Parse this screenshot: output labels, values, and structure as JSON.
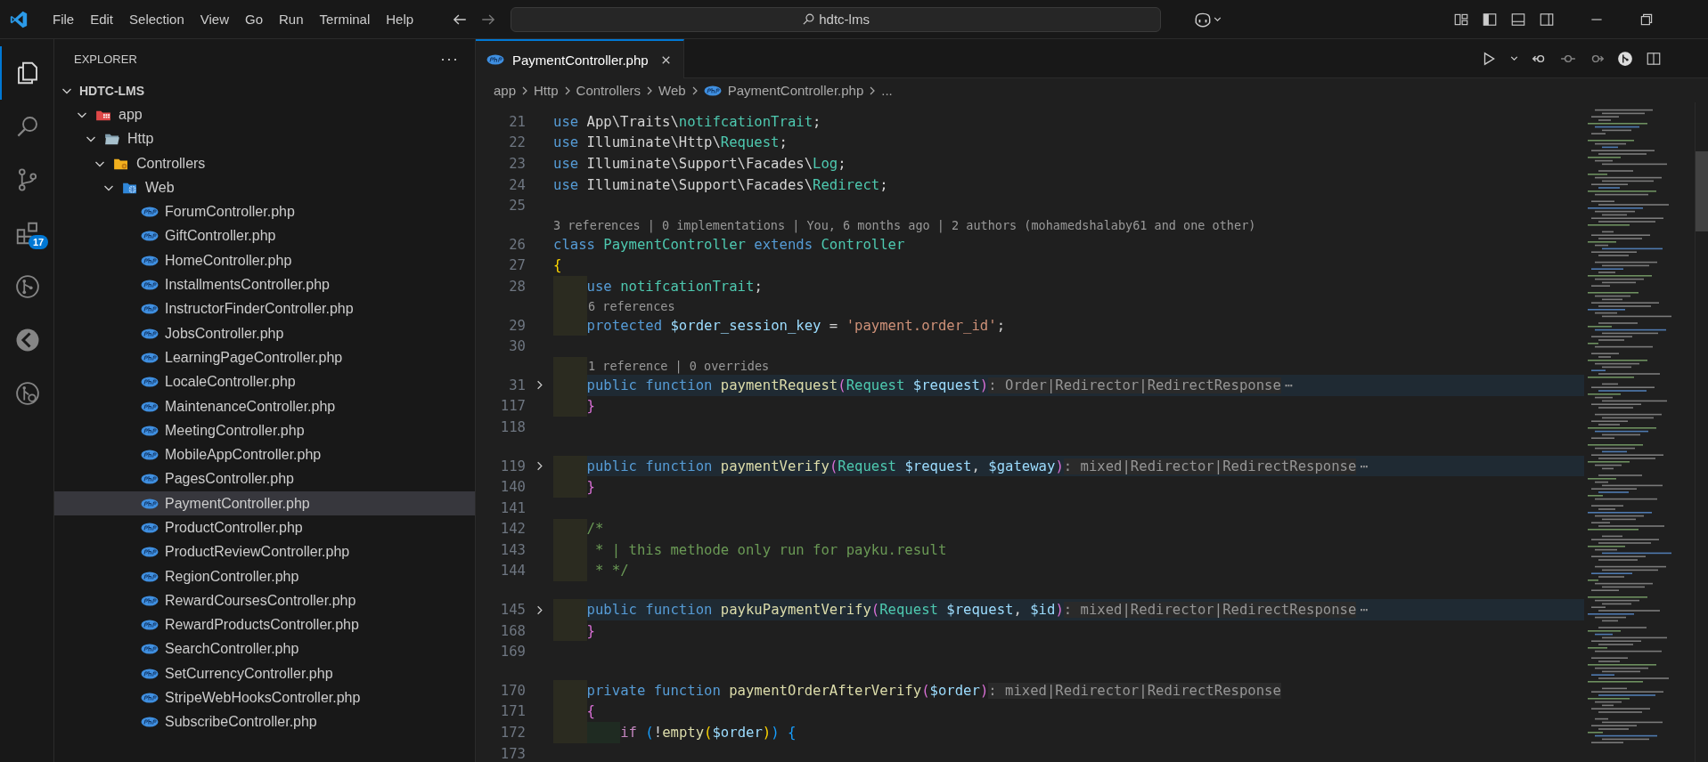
{
  "titlebar": {
    "menu": [
      "File",
      "Edit",
      "Selection",
      "View",
      "Go",
      "Run",
      "Terminal",
      "Help"
    ],
    "search": "hdtc-lms"
  },
  "activity_bar": [
    {
      "kind": "explorer",
      "selected": true
    },
    {
      "kind": "search",
      "selected": false
    },
    {
      "kind": "source-control",
      "selected": false
    },
    {
      "kind": "extensions",
      "selected": false,
      "badge": "17"
    },
    {
      "kind": "git-graph",
      "selected": false
    },
    {
      "kind": "remote",
      "selected": false
    },
    {
      "kind": "git-search",
      "selected": false
    }
  ],
  "explorer": {
    "title": "EXPLORER",
    "more": "···",
    "tree": [
      {
        "label": "HDTC-LMS",
        "kind": "root",
        "expanded": true,
        "children": [
          {
            "label": "app",
            "kind": "app-folder",
            "expanded": true,
            "children": [
              {
                "label": "Http",
                "kind": "folder",
                "expanded": true,
                "children": [
                  {
                    "label": "Controllers",
                    "kind": "controllers-folder",
                    "expanded": true,
                    "children": [
                      {
                        "label": "Web",
                        "kind": "web-folder",
                        "expanded": true,
                        "children": [
                          {
                            "label": "ForumController.php",
                            "kind": "php",
                            "selected": false
                          },
                          {
                            "label": "GiftController.php",
                            "kind": "php",
                            "selected": false
                          },
                          {
                            "label": "HomeController.php",
                            "kind": "php",
                            "selected": false
                          },
                          {
                            "label": "InstallmentsController.php",
                            "kind": "php",
                            "selected": false
                          },
                          {
                            "label": "InstructorFinderController.php",
                            "kind": "php",
                            "selected": false
                          },
                          {
                            "label": "JobsController.php",
                            "kind": "php",
                            "selected": false
                          },
                          {
                            "label": "LearningPageController.php",
                            "kind": "php",
                            "selected": false
                          },
                          {
                            "label": "LocaleController.php",
                            "kind": "php",
                            "selected": false
                          },
                          {
                            "label": "MaintenanceController.php",
                            "kind": "php",
                            "selected": false
                          },
                          {
                            "label": "MeetingController.php",
                            "kind": "php",
                            "selected": false
                          },
                          {
                            "label": "MobileAppController.php",
                            "kind": "php",
                            "selected": false
                          },
                          {
                            "label": "PagesController.php",
                            "kind": "php",
                            "selected": false
                          },
                          {
                            "label": "PaymentController.php",
                            "kind": "php",
                            "selected": true
                          },
                          {
                            "label": "ProductController.php",
                            "kind": "php",
                            "selected": false
                          },
                          {
                            "label": "ProductReviewController.php",
                            "kind": "php",
                            "selected": false
                          },
                          {
                            "label": "RegionController.php",
                            "kind": "php",
                            "selected": false
                          },
                          {
                            "label": "RewardCoursesController.php",
                            "kind": "php",
                            "selected": false
                          },
                          {
                            "label": "RewardProductsController.php",
                            "kind": "php",
                            "selected": false
                          },
                          {
                            "label": "SearchController.php",
                            "kind": "php",
                            "selected": false
                          },
                          {
                            "label": "SetCurrencyController.php",
                            "kind": "php",
                            "selected": false
                          },
                          {
                            "label": "StripeWebHooksController.php",
                            "kind": "php",
                            "selected": false
                          },
                          {
                            "label": "SubscribeController.php",
                            "kind": "php",
                            "selected": false
                          }
                        ]
                      }
                    ]
                  }
                ]
              }
            ]
          }
        ]
      }
    ]
  },
  "editor": {
    "tabs": [
      {
        "label": "PaymentController.php",
        "selected": true
      }
    ],
    "breadcrumb": [
      {
        "label": "app",
        "kind": "folder"
      },
      {
        "label": "Http",
        "kind": "folder"
      },
      {
        "label": "Controllers",
        "kind": "folder"
      },
      {
        "label": "Web",
        "kind": "folder"
      },
      {
        "label": "PaymentController.php",
        "kind": "php"
      },
      {
        "label": "...",
        "kind": "more"
      }
    ],
    "lines": [
      {
        "kind": "code",
        "num": "21",
        "folded": false,
        "tokens": [
          {
            "kind": "kw",
            "text": "use"
          },
          {
            "kind": "plain",
            "text": " App\\Traits\\"
          },
          {
            "kind": "type",
            "text": "notifcationTrait"
          },
          {
            "kind": "plain",
            "text": ";"
          }
        ]
      },
      {
        "kind": "code",
        "num": "22",
        "folded": false,
        "tokens": [
          {
            "kind": "kw",
            "text": "use"
          },
          {
            "kind": "plain",
            "text": " Illuminate\\Http\\"
          },
          {
            "kind": "type",
            "text": "Request"
          },
          {
            "kind": "plain",
            "text": ";"
          }
        ]
      },
      {
        "kind": "code",
        "num": "23",
        "folded": false,
        "tokens": [
          {
            "kind": "kw",
            "text": "use"
          },
          {
            "kind": "plain",
            "text": " Illuminate\\Support\\Facades\\"
          },
          {
            "kind": "type",
            "text": "Log"
          },
          {
            "kind": "plain",
            "text": ";"
          }
        ]
      },
      {
        "kind": "code",
        "num": "24",
        "folded": false,
        "tokens": [
          {
            "kind": "kw",
            "text": "use"
          },
          {
            "kind": "plain",
            "text": " Illuminate\\Support\\Facades\\"
          },
          {
            "kind": "type",
            "text": "Redirect"
          },
          {
            "kind": "plain",
            "text": ";"
          }
        ]
      },
      {
        "kind": "code",
        "num": "25",
        "folded": false
      },
      {
        "kind": "lens",
        "indented": false,
        "text": "3 references | 0 implementations | You, 6 months ago | 2 authors (mohamedshalaby61 and one other)"
      },
      {
        "kind": "code",
        "num": "26",
        "folded": false,
        "tokens": [
          {
            "kind": "kw",
            "text": "class "
          },
          {
            "kind": "type",
            "text": "PaymentController "
          },
          {
            "kind": "kw",
            "text": "extends "
          },
          {
            "kind": "type",
            "text": "Controller"
          }
        ]
      },
      {
        "kind": "code",
        "num": "27",
        "folded": false,
        "tokens": [
          {
            "kind": "b1",
            "text": "{"
          }
        ]
      },
      {
        "kind": "code",
        "num": "28",
        "folded": false,
        "tokens": [
          {
            "kind": "indent"
          },
          {
            "kind": "kw",
            "text": "use "
          },
          {
            "kind": "type",
            "text": "notifcationTrait"
          },
          {
            "kind": "plain",
            "text": ";"
          }
        ]
      },
      {
        "kind": "lens",
        "indented": true,
        "text": "6 references"
      },
      {
        "kind": "code",
        "num": "29",
        "folded": false,
        "tokens": [
          {
            "kind": "indent"
          },
          {
            "kind": "kw",
            "text": "protected "
          },
          {
            "kind": "var",
            "text": "$order_session_key"
          },
          {
            "kind": "plain",
            "text": " = "
          },
          {
            "kind": "string",
            "text": "'payment.order_id'"
          },
          {
            "kind": "plain",
            "text": ";"
          }
        ]
      },
      {
        "kind": "code",
        "num": "30",
        "folded": false
      },
      {
        "kind": "lens",
        "indented": true,
        "text": "1 reference | 0 overrides"
      },
      {
        "kind": "code",
        "num": "31",
        "folded": true,
        "hint": ": Order|Redirector|RedirectResponse",
        "ellipsis": "⋯",
        "tokens": [
          {
            "kind": "indent"
          },
          {
            "kind": "kw",
            "text": "public function "
          },
          {
            "kind": "func",
            "text": "paymentRequest"
          },
          {
            "kind": "b2",
            "text": "("
          },
          {
            "kind": "type",
            "text": "Request "
          },
          {
            "kind": "var",
            "text": "$request"
          },
          {
            "kind": "b2",
            "text": ")"
          }
        ]
      },
      {
        "kind": "code",
        "num": "117",
        "folded": false,
        "tokens": [
          {
            "kind": "indent"
          },
          {
            "kind": "b2",
            "text": "}"
          }
        ]
      },
      {
        "kind": "code",
        "num": "118",
        "folded": false
      },
      {
        "kind": "gap"
      },
      {
        "kind": "code",
        "num": "119",
        "folded": true,
        "hint": ": mixed|Redirector|RedirectResponse",
        "ellipsis": "⋯",
        "tokens": [
          {
            "kind": "indent"
          },
          {
            "kind": "kw",
            "text": "public function "
          },
          {
            "kind": "func",
            "text": "paymentVerify"
          },
          {
            "kind": "b2",
            "text": "("
          },
          {
            "kind": "type",
            "text": "Request "
          },
          {
            "kind": "var",
            "text": "$request"
          },
          {
            "kind": "plain",
            "text": ", "
          },
          {
            "kind": "var",
            "text": "$gateway"
          },
          {
            "kind": "b2",
            "text": ")"
          }
        ]
      },
      {
        "kind": "code",
        "num": "140",
        "folded": false,
        "tokens": [
          {
            "kind": "indent"
          },
          {
            "kind": "b2",
            "text": "}"
          }
        ]
      },
      {
        "kind": "code",
        "num": "141",
        "folded": false
      },
      {
        "kind": "code",
        "num": "142",
        "folded": false,
        "tokens": [
          {
            "kind": "indent"
          },
          {
            "kind": "comment",
            "text": "/*"
          }
        ]
      },
      {
        "kind": "code",
        "num": "143",
        "folded": false,
        "tokens": [
          {
            "kind": "indent"
          },
          {
            "kind": "comment",
            "text": " * | this methode only run for payku.result"
          }
        ]
      },
      {
        "kind": "code",
        "num": "144",
        "folded": false,
        "tokens": [
          {
            "kind": "indent"
          },
          {
            "kind": "comment",
            "text": " * */"
          }
        ]
      },
      {
        "kind": "gap"
      },
      {
        "kind": "code",
        "num": "145",
        "folded": true,
        "hint": ": mixed|Redirector|RedirectResponse",
        "ellipsis": "⋯",
        "tokens": [
          {
            "kind": "indent"
          },
          {
            "kind": "kw",
            "text": "public function "
          },
          {
            "kind": "func",
            "text": "paykuPaymentVerify"
          },
          {
            "kind": "b2",
            "text": "("
          },
          {
            "kind": "type",
            "text": "Request "
          },
          {
            "kind": "var",
            "text": "$request"
          },
          {
            "kind": "plain",
            "text": ", "
          },
          {
            "kind": "var",
            "text": "$id"
          },
          {
            "kind": "b2",
            "text": ")"
          }
        ]
      },
      {
        "kind": "code",
        "num": "168",
        "folded": false,
        "tokens": [
          {
            "kind": "indent"
          },
          {
            "kind": "b2",
            "text": "}"
          }
        ]
      },
      {
        "kind": "code",
        "num": "169",
        "folded": false
      },
      {
        "kind": "gap"
      },
      {
        "kind": "code",
        "num": "170",
        "folded": false,
        "hint": ": mixed|Redirector|RedirectResponse",
        "tokens": [
          {
            "kind": "indent"
          },
          {
            "kind": "kw",
            "text": "private function "
          },
          {
            "kind": "func",
            "text": "paymentOrderAfterVerify"
          },
          {
            "kind": "b2",
            "text": "("
          },
          {
            "kind": "var",
            "text": "$order"
          },
          {
            "kind": "b2",
            "text": ")"
          }
        ]
      },
      {
        "kind": "code",
        "num": "171",
        "folded": false,
        "tokens": [
          {
            "kind": "indent"
          },
          {
            "kind": "b2",
            "text": "{"
          }
        ]
      },
      {
        "kind": "code",
        "num": "172",
        "folded": false,
        "tokens": [
          {
            "kind": "indent"
          },
          {
            "kind": "indent"
          },
          {
            "kind": "control",
            "text": "if "
          },
          {
            "kind": "b3",
            "text": "("
          },
          {
            "kind": "plain",
            "text": "!"
          },
          {
            "kind": "func",
            "text": "empty"
          },
          {
            "kind": "b1",
            "text": "("
          },
          {
            "kind": "var",
            "text": "$order"
          },
          {
            "kind": "b1",
            "text": ")"
          },
          {
            "kind": "b3",
            "text": ")"
          },
          {
            "kind": "b3",
            "text": " {"
          }
        ]
      },
      {
        "kind": "code",
        "num": "173",
        "folded": false
      }
    ]
  }
}
